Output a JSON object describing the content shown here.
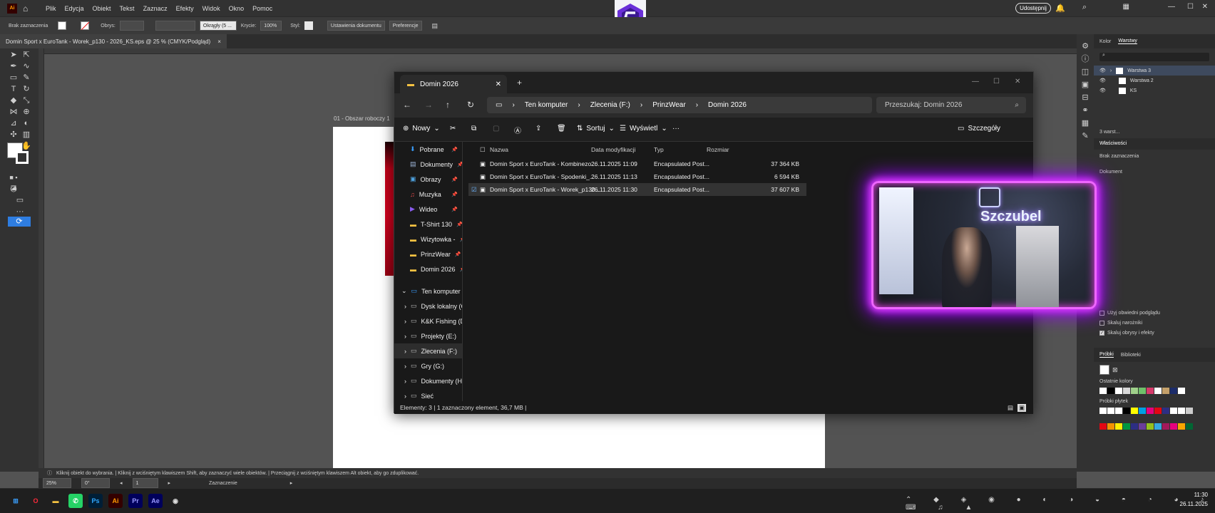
{
  "menubar": {
    "app_badge": "Ai",
    "items": [
      "Plik",
      "Edycja",
      "Obiekt",
      "Tekst",
      "Zaznacz",
      "Efekty",
      "Widok",
      "Okno",
      "Pomoc"
    ],
    "share": "Udostępnij"
  },
  "control_bar": {
    "selection_label": "Brak zaznaczenia",
    "stroke_label": "Obrys:",
    "brush_value": "Okrągły (5 ...",
    "opacity_label": "Krycie:",
    "opacity_value": "100%",
    "style_label": "Styl:",
    "doc_setup": "Ustawienia dokumentu",
    "preferences": "Preferencje"
  },
  "document_tab": {
    "title": "Domin Sport x EuroTank - Worek_p130 - 2026_KS.eps @ 25 % (CMYK/Podgląd)",
    "close": "×"
  },
  "artboard": {
    "label": "01 - Obszar roboczy 1"
  },
  "status_bar": {
    "hint": "Kliknij obiekt do wybrania.  |  Kliknij z wciśniętym klawiszem Shift, aby zaznaczyć wiele obiektów.  |  Przeciągnij z wciśniętym klawiszem Alt obiekt, aby go zduplikować."
  },
  "zoom_bar": {
    "zoom": "25%",
    "rotation": "0°",
    "artboard_num": "1",
    "mode": "Zaznaczenie"
  },
  "right_panel": {
    "tabs": [
      "Kolor",
      "Warstwy"
    ],
    "active_tab": "Warstwy",
    "layers": [
      "Warstwa 3",
      "Warstwa 2",
      "KS"
    ],
    "layer_count": "3 warst...",
    "props_tab": "Właściwości",
    "props_selection": "Brak zaznaczenia",
    "props_document": "Dokument",
    "options": [
      "Użyj obwiedni podglądu",
      "Skaluj narożniki",
      "Skaluj obrysy i efekty"
    ],
    "options_checked": [
      false,
      false,
      true
    ],
    "swatch_tabs": [
      "Próbki",
      "Biblioteki"
    ],
    "recent_colors": "Ostatnie kolory",
    "swatches_label": "Próbki płytek",
    "colors": {
      "row1": [
        "#ffffff",
        "#000000",
        "#ffffff",
        "#d8d8d8",
        "#9fd08a",
        "#6fc06a",
        "#d63a6a",
        "#ffffff",
        "#c4a06a",
        "#1c2c6a",
        "#ffffff"
      ],
      "row2": [
        "#ffffff",
        "#ffffff",
        "#ffffff",
        "#000000",
        "#ffff00",
        "#009fe3",
        "#e6007e",
        "#e30613",
        "#2d2e83",
        "#ffffff",
        "#ffffff",
        "#cccccc"
      ],
      "row3": [
        "#e30613",
        "#f39200",
        "#ffed00",
        "#009640",
        "#2d2e83",
        "#6a3d9a",
        "#95c11f",
        "#36a9e1",
        "#a3195b",
        "#e6007e",
        "#f7a600",
        "#006633"
      ]
    }
  },
  "explorer": {
    "tab_title": "Domin 2026",
    "window_controls": [
      "—",
      "☐",
      "✕"
    ],
    "new_tab": "+",
    "breadcrumb": [
      "Ten komputer",
      "Zlecenia (F:)",
      "PrinzWear",
      "Domin 2026"
    ],
    "search_placeholder": "Przeszukaj: Domin 2026",
    "toolbar": {
      "new": "Nowy",
      "sort": "Sortuj",
      "view": "Wyświetl",
      "more": "···",
      "details": "Szczegóły"
    },
    "quick_access": [
      "Pobrane",
      "Dokumenty",
      "Obrazy",
      "Muzyka",
      "Wideo",
      "T-Shirt 130",
      "Wizytowka -",
      "PrinzWear",
      "Domin 2026"
    ],
    "quick_icons": [
      "⬇",
      "▤",
      "▣",
      "♫",
      "▶",
      "▬",
      "▬",
      "▬",
      "▬"
    ],
    "quick_colors": [
      "#3aa0ff",
      "#9fb6d9",
      "#4fa3e0",
      "#e04a4a",
      "#8a5cf0",
      "#f5c242",
      "#f5c242",
      "#f5c242",
      "#f5c242"
    ],
    "this_pc": "Ten komputer",
    "drives": [
      "Dysk lokalny (C:)",
      "K&K Fishing (D:)",
      "Projekty (E:)",
      "Zlecenia (F:)",
      "Gry (G:)",
      "Dokumenty (H:)",
      "Sieć"
    ],
    "columns": [
      "Nazwa",
      "Data modyfikacji",
      "Typ",
      "Rozmiar"
    ],
    "files": [
      {
        "name": "Domin Sport x EuroTank - Kombinezo...",
        "date": "26.11.2025 11:09",
        "type": "Encapsulated Post...",
        "size": "37 364 KB"
      },
      {
        "name": "Domin Sport x EuroTank - Spodenki_...",
        "date": "26.11.2025 11:13",
        "type": "Encapsulated Post...",
        "size": "6 594 KB"
      },
      {
        "name": "Domin Sport x EuroTank - Worek_p130...",
        "date": "26.11.2025 11:30",
        "type": "Encapsulated Post...",
        "size": "37 607 KB"
      }
    ],
    "status": "Elementy: 3   |   1 zaznaczony element, 36,7 MB  |"
  },
  "webcam": {
    "neon_text": "Szczubel"
  },
  "taskbar": {
    "apps": [
      {
        "name": "Windows",
        "label": "⊞",
        "color": "#3aa0ff",
        "bg": "transparent"
      },
      {
        "name": "Opera",
        "label": "O",
        "color": "#ff2a3a",
        "bg": "transparent"
      },
      {
        "name": "Eksplorator",
        "label": "▬",
        "color": "#f5c242",
        "bg": "transparent"
      },
      {
        "name": "WhatsApp",
        "label": "✆",
        "color": "#ffffff",
        "bg": "#25d366"
      },
      {
        "name": "Photoshop",
        "label": "Ps",
        "color": "#31a8ff",
        "bg": "#001e36"
      },
      {
        "name": "Illustrator",
        "label": "Ai",
        "color": "#ff9a00",
        "bg": "#330000"
      },
      {
        "name": "Premiere",
        "label": "Pr",
        "color": "#9999ff",
        "bg": "#00005b"
      },
      {
        "name": "After Effects",
        "label": "Ae",
        "color": "#9999ff",
        "bg": "#00005b"
      },
      {
        "name": "OBS",
        "label": "◉",
        "color": "#dddddd",
        "bg": "transparent"
      }
    ],
    "time": "11:30",
    "date": "26.11.2025"
  }
}
